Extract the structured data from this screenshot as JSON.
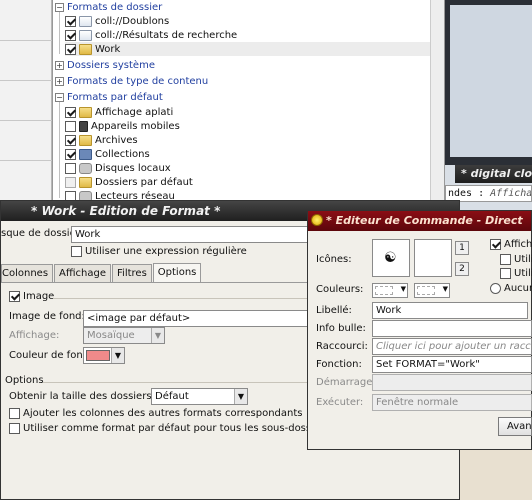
{
  "tree": {
    "groups": [
      {
        "label": "Formats de dossier"
      },
      {
        "label": "Dossiers système"
      },
      {
        "label": "Formats de type de contenu"
      },
      {
        "label": "Formats par défaut"
      }
    ],
    "folder_formats": [
      "coll://Doublons",
      "coll://Résultats de recherche",
      "Work"
    ],
    "default_formats": [
      "Affichage aplati",
      "Appareils mobiles",
      "Archives",
      "Collections",
      "Disques locaux",
      "Dossiers par défaut",
      "Lecteurs réseau"
    ]
  },
  "clock": {
    "title": "* digital clock"
  },
  "cmdbar": {
    "text": "ndes",
    "italic": "Affichag"
  },
  "format_window": {
    "title": "* Work - Edition de Format *",
    "mask_label": "sque de dossier:",
    "mask_value": "Work",
    "regex_label": "Utiliser une expression régulière",
    "tabs": [
      "Colonnes",
      "Affichage",
      "Filtres",
      "Options"
    ],
    "active_tab": "Options",
    "image_section": "Image",
    "bg_image_label": "Image de fond:",
    "bg_image_value": "<image par défaut>",
    "display_label": "Affichage:",
    "display_value": "Mosaïque",
    "bg_color_label": "Couleur de fond:",
    "bg_color": "#f08a8a",
    "options_section": "Options",
    "folder_size_label": "Obtenir la taille des dossiers:",
    "folder_size_value": "Défaut",
    "add_columns_label": "Ajouter les colonnes des autres formats correspondants",
    "use_default_label": "Utiliser comme format par défaut pour tous les sous-dossiers et archives"
  },
  "command_window": {
    "title": "* Editeur de Commande - Direct",
    "icons_label": "Icônes:",
    "colors_label": "Couleurs:",
    "label_label": "Libellé:",
    "label_value": "Work",
    "tooltip_label": "Info bulle:",
    "shortcut_label": "Raccourci:",
    "shortcut_placeholder": "Cliquer ici pour ajouter un raccourci",
    "function_label": "Fonction:",
    "function_value": "Set FORMAT=\"Work\"",
    "start_label": "Démarrage:",
    "exec_label": "Exécuter:",
    "exec_value": "Fenêtre normale",
    "btn1": "1",
    "btn2": "2",
    "show_label": "Affiche",
    "util1": "Utilis",
    "util2": "Utilis",
    "none_label": "Aucun c",
    "advanced_button": "Avanc"
  }
}
